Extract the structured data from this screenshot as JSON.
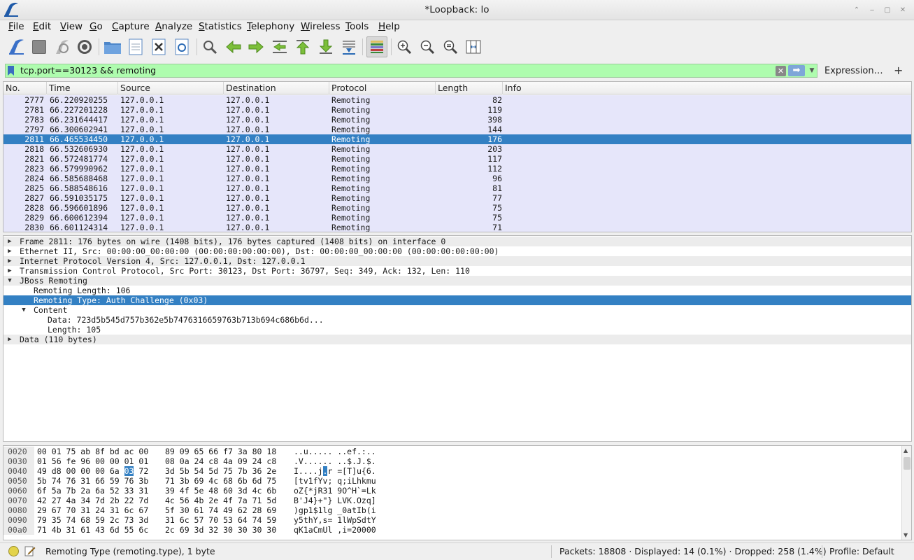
{
  "window": {
    "title": "*Loopback: lo"
  },
  "menu": [
    "File",
    "Edit",
    "View",
    "Go",
    "Capture",
    "Analyze",
    "Statistics",
    "Telephony",
    "Wireless",
    "Tools",
    "Help"
  ],
  "filter": {
    "value": "tcp.port==30123 && remoting",
    "expression_label": "Expression…",
    "plus_label": "+",
    "clear_label": "✕",
    "apply_label": "➡"
  },
  "packet_list": {
    "columns": [
      "No.",
      "Time",
      "Source",
      "Destination",
      "Protocol",
      "Length",
      "Info"
    ],
    "rows": [
      {
        "no": "2777",
        "time": "66.220920255",
        "src": "127.0.0.1",
        "dst": "127.0.0.1",
        "proto": "Remoting",
        "len": "82",
        "info": ""
      },
      {
        "no": "2781",
        "time": "66.227201228",
        "src": "127.0.0.1",
        "dst": "127.0.0.1",
        "proto": "Remoting",
        "len": "119",
        "info": ""
      },
      {
        "no": "2783",
        "time": "66.231644417",
        "src": "127.0.0.1",
        "dst": "127.0.0.1",
        "proto": "Remoting",
        "len": "398",
        "info": ""
      },
      {
        "no": "2797",
        "time": "66.300602941",
        "src": "127.0.0.1",
        "dst": "127.0.0.1",
        "proto": "Remoting",
        "len": "144",
        "info": ""
      },
      {
        "no": "2811",
        "time": "66.465534450",
        "src": "127.0.0.1",
        "dst": "127.0.0.1",
        "proto": "Remoting",
        "len": "176",
        "info": "",
        "selected": true
      },
      {
        "no": "2818",
        "time": "66.532606930",
        "src": "127.0.0.1",
        "dst": "127.0.0.1",
        "proto": "Remoting",
        "len": "203",
        "info": ""
      },
      {
        "no": "2821",
        "time": "66.572481774",
        "src": "127.0.0.1",
        "dst": "127.0.0.1",
        "proto": "Remoting",
        "len": "117",
        "info": ""
      },
      {
        "no": "2823",
        "time": "66.579990962",
        "src": "127.0.0.1",
        "dst": "127.0.0.1",
        "proto": "Remoting",
        "len": "112",
        "info": ""
      },
      {
        "no": "2824",
        "time": "66.585688468",
        "src": "127.0.0.1",
        "dst": "127.0.0.1",
        "proto": "Remoting",
        "len": "96",
        "info": ""
      },
      {
        "no": "2825",
        "time": "66.588548616",
        "src": "127.0.0.1",
        "dst": "127.0.0.1",
        "proto": "Remoting",
        "len": "81",
        "info": ""
      },
      {
        "no": "2827",
        "time": "66.591035175",
        "src": "127.0.0.1",
        "dst": "127.0.0.1",
        "proto": "Remoting",
        "len": "77",
        "info": ""
      },
      {
        "no": "2828",
        "time": "66.596601896",
        "src": "127.0.0.1",
        "dst": "127.0.0.1",
        "proto": "Remoting",
        "len": "75",
        "info": ""
      },
      {
        "no": "2829",
        "time": "66.600612394",
        "src": "127.0.0.1",
        "dst": "127.0.0.1",
        "proto": "Remoting",
        "len": "75",
        "info": ""
      },
      {
        "no": "2830",
        "time": "66.601124314",
        "src": "127.0.0.1",
        "dst": "127.0.0.1",
        "proto": "Remoting",
        "len": "71",
        "info": ""
      }
    ]
  },
  "details": [
    {
      "text": "Frame 2811: 176 bytes on wire (1408 bits), 176 bytes captured (1408 bits) on interface 0",
      "depth": 0,
      "arrow": "collapsed",
      "alt": true
    },
    {
      "text": "Ethernet II, Src: 00:00:00_00:00:00 (00:00:00:00:00:00), Dst: 00:00:00_00:00:00 (00:00:00:00:00:00)",
      "depth": 0,
      "arrow": "collapsed",
      "alt": false
    },
    {
      "text": "Internet Protocol Version 4, Src: 127.0.0.1, Dst: 127.0.0.1",
      "depth": 0,
      "arrow": "collapsed",
      "alt": true
    },
    {
      "text": "Transmission Control Protocol, Src Port: 30123, Dst Port: 36797, Seq: 349, Ack: 132, Len: 110",
      "depth": 0,
      "arrow": "collapsed",
      "alt": false
    },
    {
      "text": "JBoss Remoting",
      "depth": 0,
      "arrow": "expanded",
      "alt": true
    },
    {
      "text": "Remoting Length: 106",
      "depth": 1,
      "arrow": "none",
      "alt": false
    },
    {
      "text": "Remoting Type: Auth Challenge (0x03)",
      "depth": 1,
      "arrow": "none",
      "alt": false,
      "selected": true
    },
    {
      "text": "Content",
      "depth": 1,
      "arrow": "expanded",
      "alt": false
    },
    {
      "text": "Data: 723d5b545d757b362e5b7476316659763b713b694c686b6d...",
      "depth": 2,
      "arrow": "none",
      "alt": false
    },
    {
      "text": "Length: 105",
      "depth": 2,
      "arrow": "none",
      "alt": false
    },
    {
      "text": "Data (110 bytes)",
      "depth": 0,
      "arrow": "collapsed",
      "alt": true
    }
  ],
  "bytes": [
    {
      "offset": "0020",
      "hex1": "00 01 75 ab 8f bd ac 00",
      "hex2": "89 09 65 66 f7 3a 80 18",
      "ascii": "..u..... ..ef.:.."
    },
    {
      "offset": "0030",
      "hex1": "01 56 fe 96 00 00 01 01",
      "hex2": "08 0a 24 c8 4a 09 24 c8",
      "ascii": ".V...... ..$.J.$."
    },
    {
      "offset": "0040",
      "hex1a": "49 d8 00 00 00 6a ",
      "hex1hl": "03",
      "hex1b": " 72",
      "hex2": "3d 5b 54 5d 75 7b 36 2e",
      "ascii_a": "I....j",
      "ascii_hl": ".",
      "ascii_b": "r =[T]u{6."
    },
    {
      "offset": "0050",
      "hex1": "5b 74 76 31 66 59 76 3b",
      "hex2": "71 3b 69 4c 68 6b 6d 75",
      "ascii": "[tv1fYv; q;iLhkmu"
    },
    {
      "offset": "0060",
      "hex1": "6f 5a 7b 2a 6a 52 33 31",
      "hex2": "39 4f 5e 48 60 3d 4c 6b",
      "ascii": "oZ{*jR31 9O^H`=Lk"
    },
    {
      "offset": "0070",
      "hex1": "42 27 4a 34 7d 2b 22 7d",
      "hex2": "4c 56 4b 2e 4f 7a 71 5d",
      "ascii": "B'J4}+\"} LVK.Ozq]"
    },
    {
      "offset": "0080",
      "hex1": "29 67 70 31 24 31 6c 67",
      "hex2": "5f 30 61 74 49 62 28 69",
      "ascii": ")gp1$1lg _0atIb(i"
    },
    {
      "offset": "0090",
      "hex1": "79 35 74 68 59 2c 73 3d",
      "hex2": "31 6c 57 70 53 64 74 59",
      "ascii": "y5thY,s= 1lWpSdtY"
    },
    {
      "offset": "00a0",
      "hex1": "71 4b 31 61 43 6d 55 6c",
      "hex2": "2c 69 3d 32 30 30 30 30",
      "ascii": "qK1aCmUl ,i=20000"
    }
  ],
  "status": {
    "field": "Remoting Type (remoting.type), 1 byte",
    "packets": "Packets: 18808 · Displayed: 14 (0.1%) · Dropped: 258 (1.4%)",
    "profile": "Profile: Default"
  },
  "colors": {
    "selection": "#3380c3",
    "row_bg": "#e6e6fa",
    "filter_ok": "#aefcae"
  }
}
